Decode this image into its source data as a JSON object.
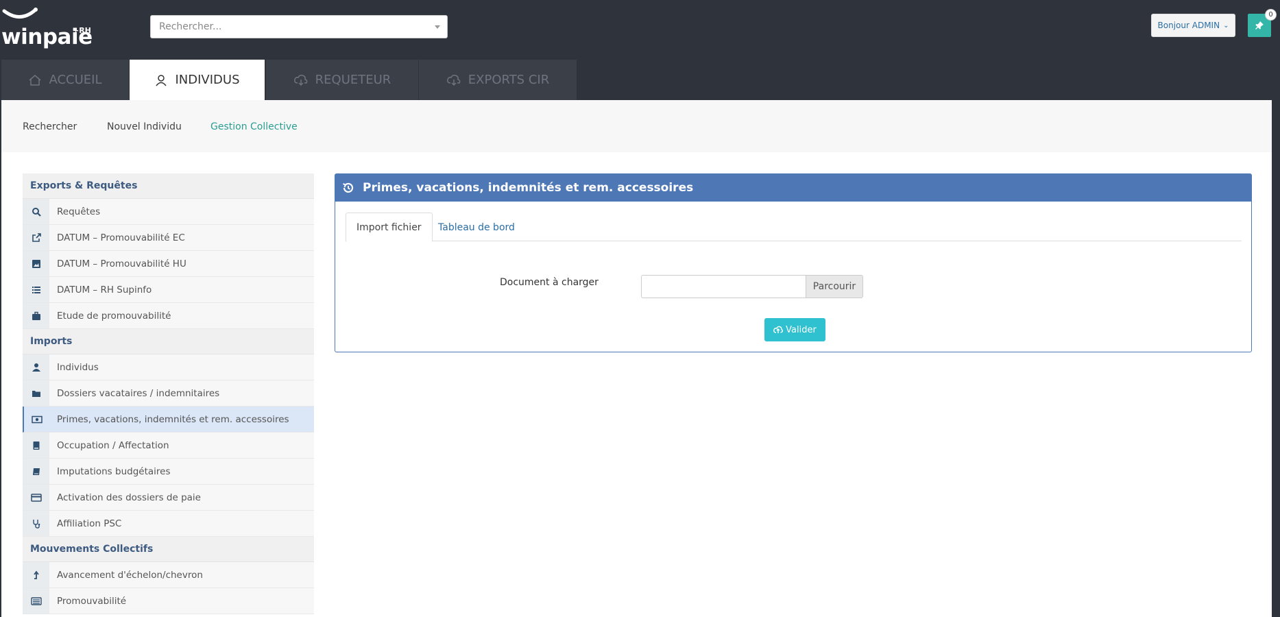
{
  "brand": {
    "name": "winpaie",
    "suffix": "+RH"
  },
  "search": {
    "placeholder": "Rechercher..."
  },
  "user_menu": {
    "label": "Bonjour ADMIN"
  },
  "pin": {
    "badge_count": "0"
  },
  "main_tabs": [
    {
      "label": "ACCUEIL",
      "icon": "home-icon"
    },
    {
      "label": "INDIVIDUS",
      "icon": "user-icon",
      "active": true
    },
    {
      "label": "REQUETEUR",
      "icon": "cloud-download-icon"
    },
    {
      "label": "EXPORTS CIR",
      "icon": "cloud-download-icon"
    }
  ],
  "subnav": [
    {
      "label": "Rechercher"
    },
    {
      "label": "Nouvel Individu"
    },
    {
      "label": "Gestion Collective",
      "active": true
    }
  ],
  "sidebar": {
    "groups": [
      {
        "title": "Exports & Requêtes",
        "items": [
          {
            "label": "Requêtes",
            "icon": "search-icon"
          },
          {
            "label": "DATUM – Promouvabilité EC",
            "icon": "external-link-icon"
          },
          {
            "label": "DATUM – Promouvabilité HU",
            "icon": "image-icon"
          },
          {
            "label": "DATUM – RH Supinfo",
            "icon": "list-icon"
          },
          {
            "label": "Etude de promouvabilité",
            "icon": "briefcase-icon"
          }
        ]
      },
      {
        "title": "Imports",
        "items": [
          {
            "label": "Individus",
            "icon": "user-icon"
          },
          {
            "label": "Dossiers vacataires / indemnitaires",
            "icon": "folder-icon"
          },
          {
            "label": "Primes, vacations, indemnités et rem. accessoires",
            "icon": "money-icon",
            "active": true
          },
          {
            "label": "Occupation / Affectation",
            "icon": "book-icon"
          },
          {
            "label": "Imputations budgétaires",
            "icon": "notebook-icon"
          },
          {
            "label": "Activation des dossiers de paie",
            "icon": "credit-card-icon"
          },
          {
            "label": "Affiliation PSC",
            "icon": "stethoscope-icon"
          }
        ]
      },
      {
        "title": "Mouvements Collectifs",
        "items": [
          {
            "label": "Avancement d'échelon/chevron",
            "icon": "arrow-up-icon"
          },
          {
            "label": "Promouvabilité",
            "icon": "list-alt-icon"
          }
        ]
      }
    ]
  },
  "panel": {
    "title": "Primes, vacations, indemnités et rem. accessoires",
    "icon": "history-icon",
    "tabs": [
      {
        "label": "Import fichier",
        "active": true
      },
      {
        "label": "Tableau de bord"
      }
    ],
    "document_label": "Document à charger",
    "file_value": "",
    "browse_label": "Parcourir",
    "submit_label": "Valider"
  },
  "colors": {
    "topbar": "#2f333c",
    "panel_header": "#4e77b6",
    "accent_teal": "#2a9d92",
    "submit_button": "#2fc1cf",
    "pin_button": "#33b5a8"
  }
}
